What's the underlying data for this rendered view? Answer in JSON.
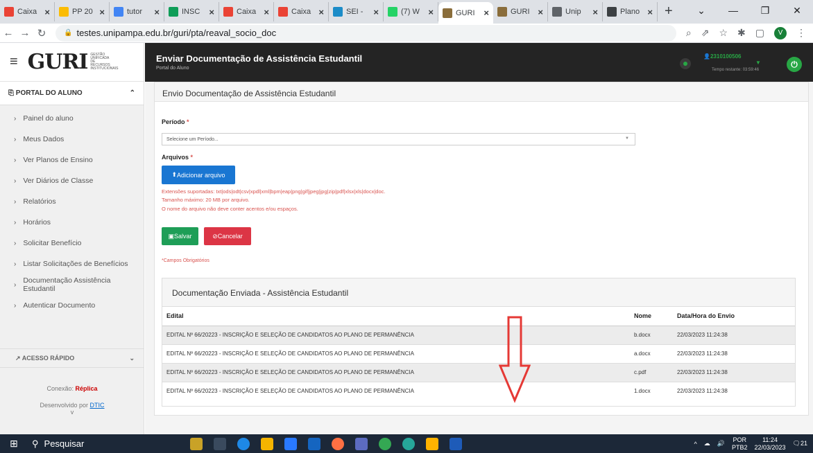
{
  "browser": {
    "tabs": [
      {
        "label": "Caixa",
        "fav": "gmail-icon",
        "color": "#ea4335"
      },
      {
        "label": "PP 20",
        "fav": "drive-icon",
        "color": "#fbbc04"
      },
      {
        "label": "tutor",
        "fav": "forms-icon",
        "color": "#4285f4"
      },
      {
        "label": "INSC",
        "fav": "sheets-icon",
        "color": "#0f9d58"
      },
      {
        "label": "Caixa",
        "fav": "gmail-icon",
        "color": "#ea4335"
      },
      {
        "label": "Caixa",
        "fav": "gmail-icon",
        "color": "#ea4335"
      },
      {
        "label": "SEI -",
        "fav": "sei-icon",
        "color": "#1c8cc8"
      },
      {
        "label": "(7) W",
        "fav": "whatsapp-icon",
        "color": "#25d366"
      },
      {
        "label": "GURI",
        "fav": "guri-icon",
        "color": "#8a6d3b"
      },
      {
        "label": "GURI",
        "fav": "guri-icon",
        "color": "#8a6d3b"
      },
      {
        "label": "Unip",
        "fav": "globe-icon",
        "color": "#5f6368"
      },
      {
        "label": "Plano",
        "fav": "doc-icon",
        "color": "#3c4043"
      }
    ],
    "url": "testes.unipampa.edu.br/guri/pta/reaval_socio_doc",
    "profile_initial": "V"
  },
  "sidebar": {
    "logo": "GURI",
    "logo_sub": "GESTÃO UNIFICADA DE RECURSOS INSTITUCIONAIS",
    "section_title": "PORTAL DO ALUNO",
    "items": [
      "Painel do aluno",
      "Meus Dados",
      "Ver Planos de Ensino",
      "Ver Diários de Classe",
      "Relatórios",
      "Horários",
      "Solicitar Benefício",
      "Listar Solicitações de Benefícios",
      "Documentação Assistência Estudantil",
      "Autenticar Documento"
    ],
    "acesso": "ACESSO RÁPIDO",
    "conexao_label": "Conexão: ",
    "conexao_value": "Réplica",
    "dev_label": "Desenvolvido por ",
    "dev_link": "DTIC",
    "version": "v"
  },
  "header": {
    "title": "Enviar Documentação de Assistência Estudantil",
    "subtitle": "Portal do Aluno",
    "user": "2310100506",
    "time": "Tempo restante: 03:59:46"
  },
  "form": {
    "card_title": "Envio Documentação de Assistência Estudantil",
    "periodo_label": "Período",
    "periodo_placeholder": "Selecione um Período...",
    "arquivos_label": "Arquivos",
    "add_button": "Adicionar arquivo",
    "hint1": "Extensões suportadas: txt|ods|odt|csv|xpdl|xml|bpm|eap|png|gif|jpeg|jpg|zip|pdf|xlsx|xls|docx|doc.",
    "hint2": "Tamanho máximo: 20 MB por arquivo.",
    "hint3": "O nome do arquivo não deve conter acentos e/ou espaços.",
    "save_button": "Salvar",
    "cancel_button": "Cancelar",
    "required_note": "*Campos Obrigatórios"
  },
  "docs": {
    "title": "Documentação Enviada - Assistência Estudantil",
    "columns": [
      "Edital",
      "Nome",
      "Data/Hora do Envio"
    ],
    "rows": [
      [
        "EDITAL Nº 66/20223 - INSCRIÇÃO E SELEÇÃO DE CANDIDATOS AO PLANO DE PERMANÊNCIA",
        "b.docx",
        "22/03/2023 11:24:38"
      ],
      [
        "EDITAL Nº 66/20223 - INSCRIÇÃO E SELEÇÃO DE CANDIDATOS AO PLANO DE PERMANÊNCIA",
        "a.docx",
        "22/03/2023 11:24:38"
      ],
      [
        "EDITAL Nº 66/20223 - INSCRIÇÃO E SELEÇÃO DE CANDIDATOS AO PLANO DE PERMANÊNCIA",
        "c.pdf",
        "22/03/2023 11:24:38"
      ],
      [
        "EDITAL Nº 66/20223 - INSCRIÇÃO E SELEÇÃO DE CANDIDATOS AO PLANO DE PERMANÊNCIA",
        "1.docx",
        "22/03/2023 11:24:38"
      ]
    ]
  },
  "taskbar": {
    "search": "Pesquisar",
    "lang1": "POR",
    "lang2": "PTB2",
    "time": "11:24",
    "date": "22/03/2023",
    "notif": "21"
  },
  "colors": {
    "accent": "#1976d2",
    "success": "#1e9e57",
    "danger": "#dc3545",
    "arrow": "#e53935"
  }
}
